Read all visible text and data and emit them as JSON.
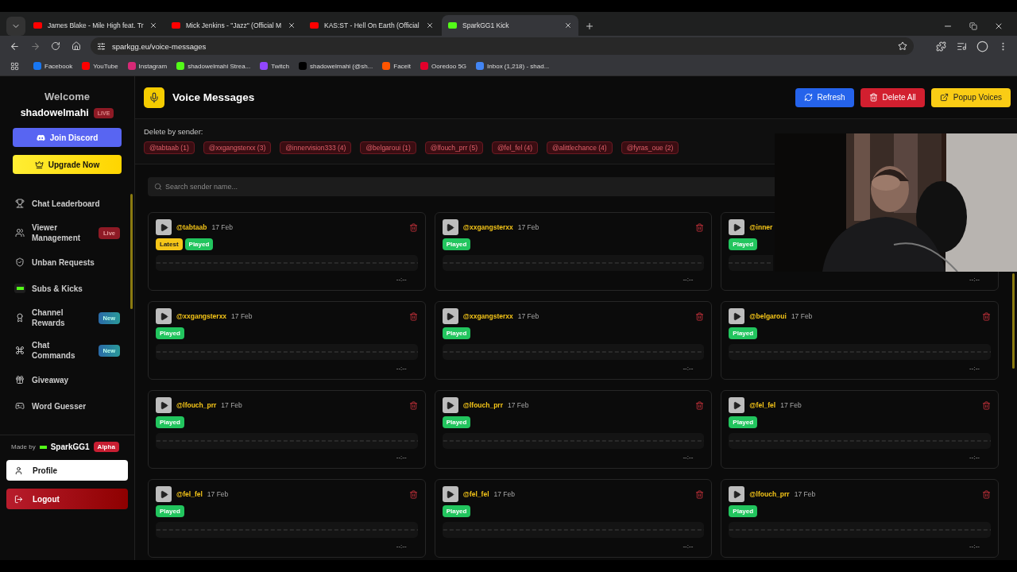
{
  "browser": {
    "tabs": [
      {
        "title": "James Blake - Mile High feat. Tr",
        "color": "#ff0000",
        "selected": false
      },
      {
        "title": "Mick Jenkins - \"Jazz\" (Official M",
        "color": "#ff0000",
        "selected": false
      },
      {
        "title": "KAS:ST - Hell On Earth (Official",
        "color": "#ff0000",
        "selected": false
      },
      {
        "title": "SparkGG1 Kick",
        "color": "#53fc18",
        "selected": true
      }
    ],
    "url": "sparkgg.eu/voice-messages",
    "bookmarks": [
      {
        "label": "Facebook",
        "color": "#1877f2"
      },
      {
        "label": "YouTube",
        "color": "#ff0000"
      },
      {
        "label": "Instagram",
        "color": "#d62976"
      },
      {
        "label": "shadowelmahi Strea...",
        "color": "#53fc18"
      },
      {
        "label": "Twitch",
        "color": "#9146ff"
      },
      {
        "label": "shadowelmahi (@sh...",
        "color": "#000000"
      },
      {
        "label": "Faceit",
        "color": "#ff5500"
      },
      {
        "label": "Ooredoo 5G",
        "color": "#e4002b"
      },
      {
        "label": "Inbox (1,218) - shad...",
        "color": "#4285f4"
      }
    ]
  },
  "sidebar": {
    "welcome": "Welcome",
    "username": "shadowelmahi",
    "live_badge": "LIVE",
    "discord_button": "Join Discord",
    "upgrade_button": "Upgrade Now",
    "nav": [
      {
        "label": "Chat Leaderboard"
      },
      {
        "label": "Viewer Management",
        "badge": {
          "text": "Live",
          "kind": "live"
        }
      },
      {
        "label": "Unban Requests"
      },
      {
        "label": "Subs & Kicks"
      },
      {
        "label": "Channel Rewards",
        "badge": {
          "text": "New",
          "kind": "new"
        }
      },
      {
        "label": "Chat Commands",
        "badge": {
          "text": "New",
          "kind": "new"
        }
      },
      {
        "label": "Giveaway"
      },
      {
        "label": "Word Guesser"
      }
    ],
    "made_by": "Made by",
    "brand": "SparkGG1",
    "brand_badge": "Alpha",
    "profile": "Profile",
    "logout": "Logout"
  },
  "header": {
    "title": "Voice Messages",
    "buttons": [
      {
        "label": "Refresh",
        "kind": "refresh"
      },
      {
        "label": "Delete All",
        "kind": "delete"
      },
      {
        "label": "Popup Voices",
        "kind": "popup"
      }
    ]
  },
  "filter": {
    "label": "Delete by sender:",
    "senders": [
      "@tabtaab (1)",
      "@xxgangsterxx (3)",
      "@innervision333 (4)",
      "@belgaroui (1)",
      "@lfouch_prr (5)",
      "@fel_fel (4)",
      "@alittlechance (4)",
      "@fyras_oue (2)"
    ]
  },
  "search": {
    "placeholder": "Search sender name...",
    "covered": true
  },
  "messages": [
    {
      "sender": "@tabtaab",
      "date": "17 Feb",
      "badges": [
        {
          "text": "Latest",
          "kind": "latest"
        },
        {
          "text": "Played",
          "kind": "played"
        }
      ],
      "time": "--:--",
      "covered": false
    },
    {
      "sender": "@xxgangsterxx",
      "date": "17 Feb",
      "badges": [
        {
          "text": "Played",
          "kind": "played"
        }
      ],
      "time": "--:--",
      "covered": false
    },
    {
      "sender": "@inner",
      "badges": [
        {
          "text": "Played",
          "kind": "played"
        }
      ],
      "time": "--:--",
      "covered": true
    },
    {
      "sender": "@xxgangsterxx",
      "date": "17 Feb",
      "badges": [
        {
          "text": "Played",
          "kind": "played"
        }
      ],
      "time": "--:--",
      "covered": false
    },
    {
      "sender": "@xxgangsterxx",
      "date": "17 Feb",
      "badges": [
        {
          "text": "Played",
          "kind": "played"
        }
      ],
      "time": "--:--",
      "covered": false
    },
    {
      "sender": "@belgaroui",
      "date": "17 Feb",
      "badges": [
        {
          "text": "Played",
          "kind": "played"
        }
      ],
      "time": "--:--",
      "covered": false
    },
    {
      "sender": "@lfouch_prr",
      "date": "17 Feb",
      "badges": [
        {
          "text": "Played",
          "kind": "played"
        }
      ],
      "time": "--:--",
      "covered": false
    },
    {
      "sender": "@lfouch_prr",
      "date": "17 Feb",
      "badges": [
        {
          "text": "Played",
          "kind": "played"
        }
      ],
      "time": "--:--",
      "covered": false
    },
    {
      "sender": "@fel_fel",
      "date": "17 Feb",
      "badges": [
        {
          "text": "Played",
          "kind": "played"
        }
      ],
      "time": "--:--",
      "covered": false
    },
    {
      "sender": "@fel_fel",
      "date": "17 Feb",
      "badges": [
        {
          "text": "Played",
          "kind": "played"
        }
      ],
      "time": "--:--",
      "covered": false
    },
    {
      "sender": "@fel_fel",
      "date": "17 Feb",
      "badges": [
        {
          "text": "Played",
          "kind": "played"
        }
      ],
      "time": "--:--",
      "covered": false
    },
    {
      "sender": "@lfouch_prr",
      "date": "17 Feb",
      "badges": [
        {
          "text": "Played",
          "kind": "played"
        }
      ],
      "time": "--:--",
      "covered": false
    }
  ]
}
